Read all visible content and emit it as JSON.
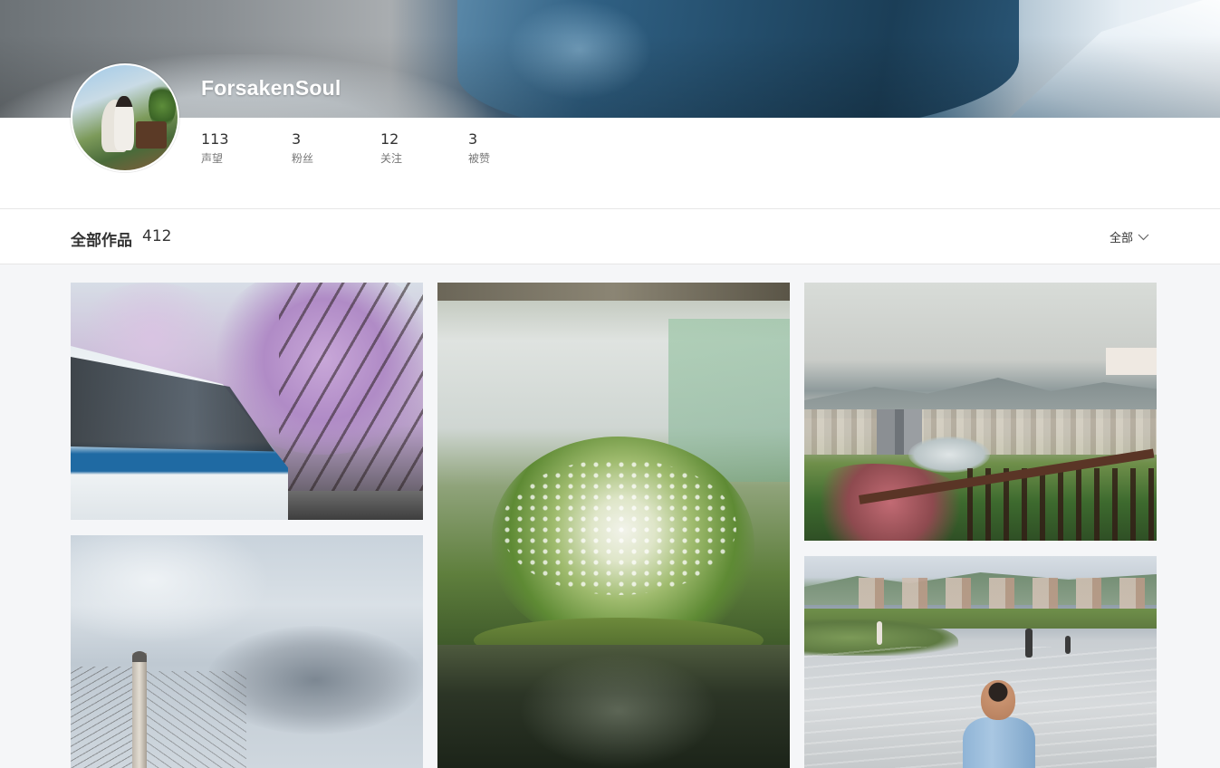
{
  "profile": {
    "username": "ForsakenSoul",
    "stats": [
      {
        "value": "113",
        "label": "声望"
      },
      {
        "value": "3",
        "label": "粉丝"
      },
      {
        "value": "12",
        "label": "关注"
      },
      {
        "value": "3",
        "label": "被赞"
      }
    ]
  },
  "works": {
    "title": "全部作品",
    "count": "412",
    "filter_label": "全部",
    "filter_icon": "chevron-down-icon"
  },
  "photos": [
    {
      "subject": "bus-under-blossoming-trees"
    },
    {
      "subject": "tree-by-pond"
    },
    {
      "subject": "city-view-with-railing"
    },
    {
      "subject": "bridge-and-clouds"
    },
    {
      "subject": "river-with-boy"
    }
  ],
  "colors": {
    "background": "#f5f6f8",
    "panel": "#ffffff",
    "text": "#333333",
    "muted_text": "#777777",
    "divider": "#e6e6e6"
  }
}
